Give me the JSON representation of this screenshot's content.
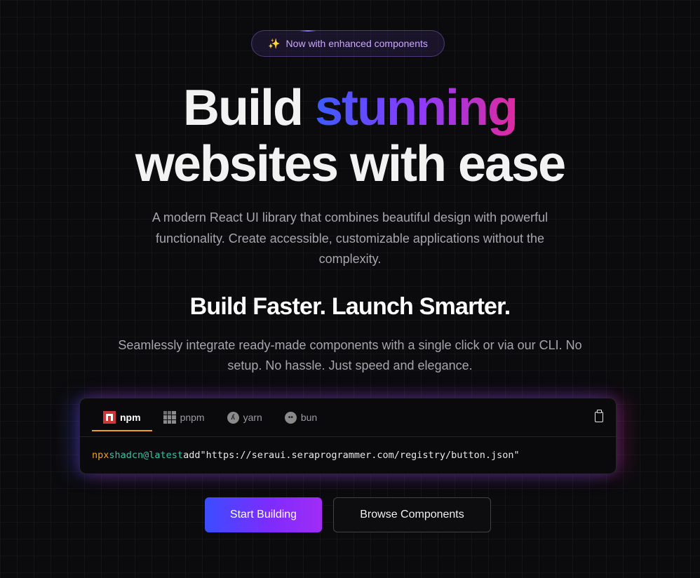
{
  "badge": {
    "icon": "sparkles-icon",
    "icon_glyph": "✨",
    "text": "Now with enhanced components"
  },
  "hero": {
    "title_line1_prefix": "Build",
    "title_line1_highlight": "stunning",
    "title_line2": "websites with ease",
    "highlight_gradient": [
      "#3b5bff",
      "#8a3bff",
      "#e02a9e"
    ],
    "description": "A modern React UI library that combines beautiful design with powerful functionality. Create accessible, customizable applications without the complexity."
  },
  "subsection": {
    "heading": "Build Faster. Launch Smarter.",
    "description": "Seamlessly integrate ready-made components with a single click or via our CLI. No setup. No hassle. Just speed and elegance."
  },
  "install": {
    "tabs": [
      {
        "label": "npm",
        "icon": "npm-icon",
        "active": true
      },
      {
        "label": "pnpm",
        "icon": "pnpm-icon",
        "active": false
      },
      {
        "label": "yarn",
        "icon": "yarn-icon",
        "active": false
      },
      {
        "label": "bun",
        "icon": "bun-icon",
        "active": false
      }
    ],
    "copy_icon": "clipboard-icon",
    "command": {
      "runner": "npx",
      "package": "shadcn@latest",
      "action": "add",
      "argument": "\"https://seraui.seraprogrammer.com/registry/button.json\""
    },
    "colors": {
      "runner": "#f0a020",
      "package": "#2fc4a8",
      "active_tab_underline": "#f0a020"
    }
  },
  "actions": {
    "primary_label": "Start Building",
    "secondary_label": "Browse Components"
  }
}
